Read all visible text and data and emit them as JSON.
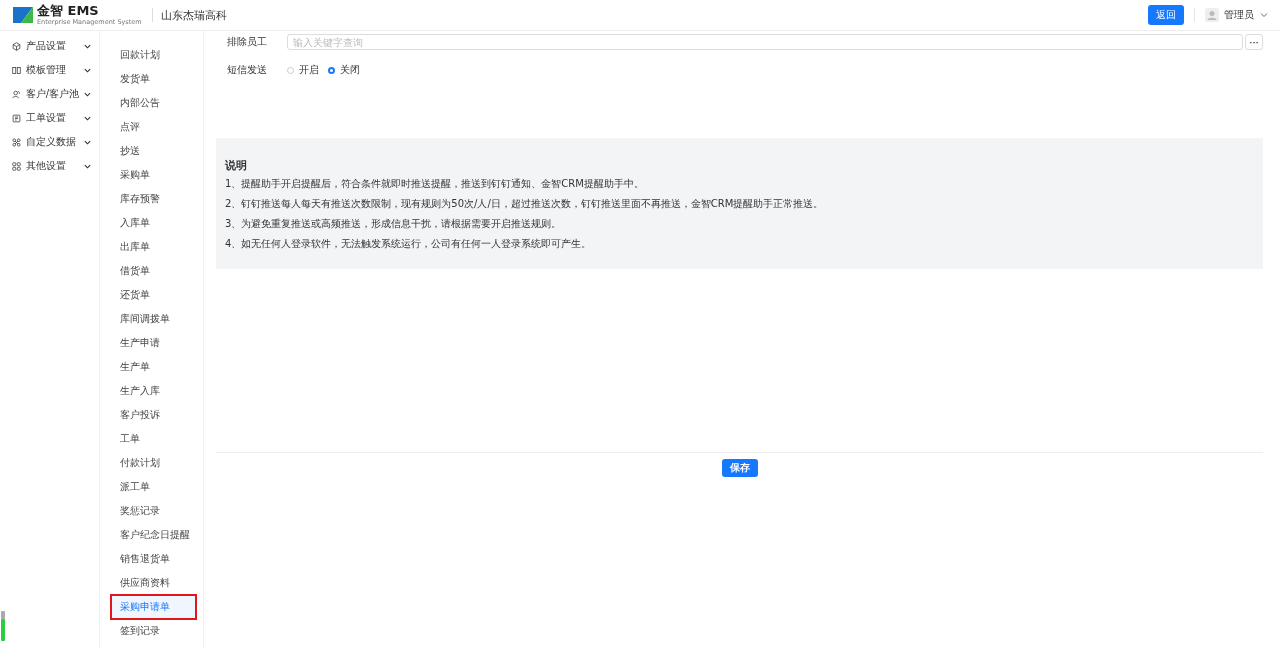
{
  "header": {
    "logo_text": "金智 EMS",
    "logo_subtitle": "Enterprise Management System",
    "company": "山东杰瑞高科",
    "back_button": "返回",
    "user": "管理员"
  },
  "sidebar": {
    "items": [
      {
        "label": "产品设置"
      },
      {
        "label": "模板管理"
      },
      {
        "label": "客户/客户池"
      },
      {
        "label": "工单设置"
      },
      {
        "label": "自定义数据"
      },
      {
        "label": "其他设置"
      }
    ]
  },
  "submenu": {
    "items": [
      {
        "label": "回款计划",
        "selected": false
      },
      {
        "label": "发货单",
        "selected": false
      },
      {
        "label": "内部公告",
        "selected": false
      },
      {
        "label": "点评",
        "selected": false
      },
      {
        "label": "抄送",
        "selected": false
      },
      {
        "label": "采购单",
        "selected": false
      },
      {
        "label": "库存预警",
        "selected": false
      },
      {
        "label": "入库单",
        "selected": false
      },
      {
        "label": "出库单",
        "selected": false
      },
      {
        "label": "借货单",
        "selected": false
      },
      {
        "label": "还货单",
        "selected": false
      },
      {
        "label": "库间调拨单",
        "selected": false
      },
      {
        "label": "生产申请",
        "selected": false
      },
      {
        "label": "生产单",
        "selected": false
      },
      {
        "label": "生产入库",
        "selected": false
      },
      {
        "label": "客户投诉",
        "selected": false
      },
      {
        "label": "工单",
        "selected": false
      },
      {
        "label": "付款计划",
        "selected": false
      },
      {
        "label": "派工单",
        "selected": false
      },
      {
        "label": "奖惩记录",
        "selected": false
      },
      {
        "label": "客户纪念日提醒",
        "selected": false
      },
      {
        "label": "销售退货单",
        "selected": false
      },
      {
        "label": "供应商资料",
        "selected": false
      },
      {
        "label": "采购申请单",
        "selected": true
      },
      {
        "label": "签到记录",
        "selected": false
      }
    ]
  },
  "form": {
    "exclude_label": "排除员工",
    "exclude_placeholder": "输入关键字查询",
    "more_button": "···",
    "sms_label": "短信发送",
    "sms_options": [
      {
        "label": "开启",
        "selected": false
      },
      {
        "label": "关闭",
        "selected": true
      }
    ]
  },
  "notes": {
    "title": "说明",
    "lines": [
      "1、提醒助手开启提醒后，符合条件就即时推送提醒，推送到钉钉通知、金智CRM提醒助手中。",
      "2、钉钉推送每人每天有推送次数限制，现有规则为50次/人/日，超过推送次数，钉钉推送里面不再推送，金智CRM提醒助手正常推送。",
      "3、为避免重复推送或高频推送，形成信息干扰，请根据需要开启推送规则。",
      "4、如无任何人登录软件，无法触发系统运行，公司有任何一人登录系统即可产生。"
    ]
  },
  "save_button": "保存"
}
